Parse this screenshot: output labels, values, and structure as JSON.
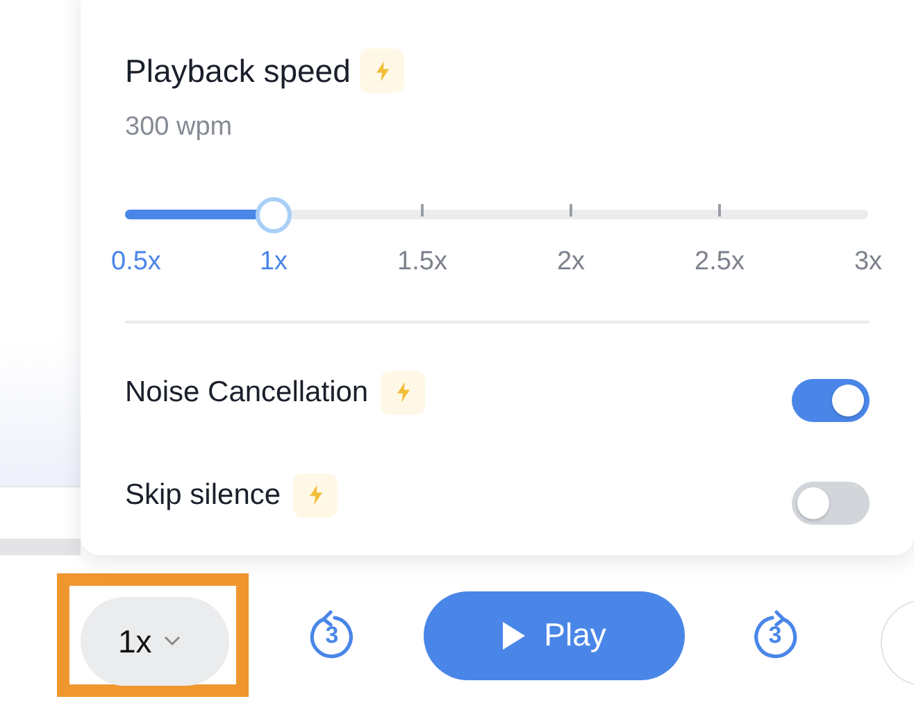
{
  "speed_popover": {
    "title": "Playback speed",
    "premium": true,
    "reading": "300 wpm",
    "slider": {
      "level": 0.2,
      "marks": [
        "0.5x",
        "1x",
        "1.5x",
        "2x",
        "2.5x",
        "3x"
      ]
    },
    "toggles": [
      {
        "label": "Noise Cancellation",
        "premium": true,
        "on": true
      },
      {
        "label": "Skip silence",
        "premium": true,
        "on": false
      }
    ]
  },
  "player": {
    "speed": "1x",
    "speed_highlighted": true,
    "rewind": "3",
    "play": "Play",
    "forward": "3"
  }
}
